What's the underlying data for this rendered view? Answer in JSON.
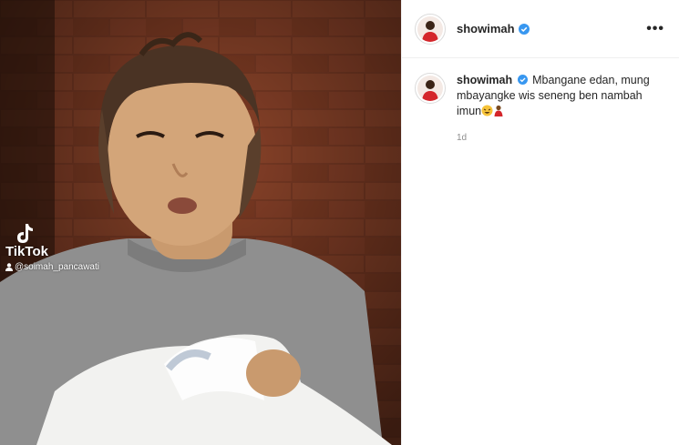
{
  "video": {
    "watermark_brand": "TikTok",
    "watermark_user": "@soimah_pancawati",
    "logo_icon": "tiktok-icon"
  },
  "header": {
    "username": "showimah",
    "verified_icon": "verified-badge-icon",
    "more_label": "•••"
  },
  "caption": {
    "username": "showimah",
    "text": "Mbangane edan, mung mbayangke wis seneng ben nambah imun",
    "emojis": [
      "laughing-face-emoji",
      "woman-in-red-emoji"
    ],
    "timestamp": "1d"
  },
  "colors": {
    "brick": "#6e3320",
    "verified": "#3897f0",
    "muted_text": "#8e8e8e"
  }
}
